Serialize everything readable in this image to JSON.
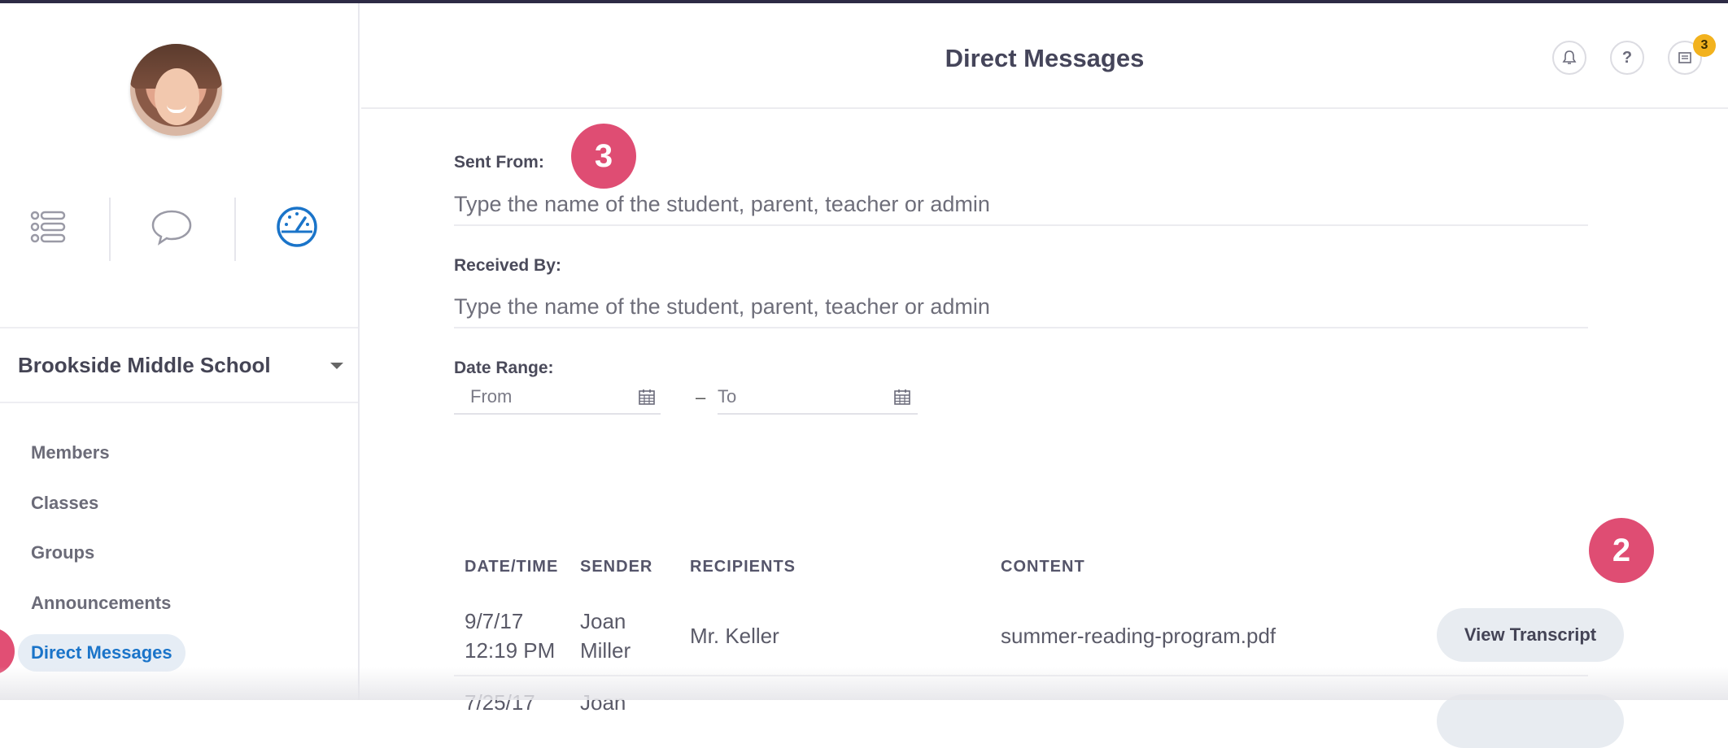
{
  "header": {
    "title": "Direct Messages",
    "notification_count": "3"
  },
  "sidebar": {
    "school_name": "Brookside Middle School",
    "items": [
      {
        "label": "Members",
        "active": false
      },
      {
        "label": "Classes",
        "active": false
      },
      {
        "label": "Groups",
        "active": false
      },
      {
        "label": "Announcements",
        "active": false
      },
      {
        "label": "Direct Messages",
        "active": true
      }
    ],
    "icons": [
      "list-icon",
      "chat-bubble-icon",
      "dashboard-gauge-icon"
    ],
    "active_icon_color": "#1a74c9"
  },
  "filters": {
    "sent_from_label": "Sent From:",
    "sent_from_placeholder": "Type the name of the student, parent, teacher or admin",
    "received_by_label": "Received By:",
    "received_by_placeholder": "Type the name of the student, parent, teacher or admin",
    "date_range_label": "Date Range:",
    "date_from_placeholder": "From",
    "date_to_placeholder": "To",
    "date_separator": "–"
  },
  "steps": {
    "step_3": "3",
    "step_2": "2"
  },
  "table": {
    "headers": [
      "DATE/TIME",
      "SENDER",
      "RECIPIENTS",
      "CONTENT"
    ],
    "rows": [
      {
        "date": "9/7/17",
        "time": "12:19 PM",
        "sender_first": "Joan",
        "sender_last": "Miller",
        "recipients": "Mr. Keller",
        "content": "summer-reading-program.pdf",
        "action": "View Transcript"
      },
      {
        "date": "7/25/17",
        "sender_first": "Joan"
      }
    ]
  },
  "colors": {
    "accent": "#1a74c9",
    "step_badge": "#df4d73",
    "notification_badge": "#f2b21e"
  }
}
